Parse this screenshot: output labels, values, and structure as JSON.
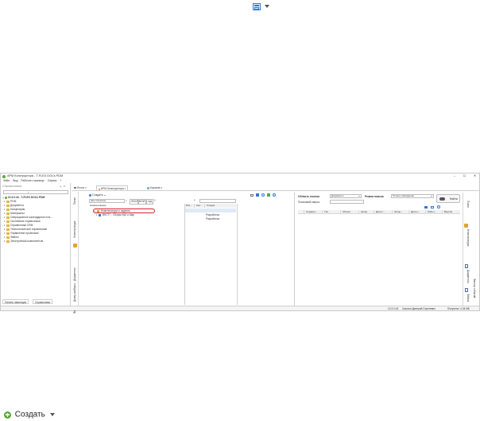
{
  "top_icon": {
    "name": "window-list-icon"
  },
  "window": {
    "title": "АРМ Конструктора - T-FLEX DOCs PDM",
    "controls": {
      "minimize": "–",
      "maximize": "☐",
      "close": "✕"
    }
  },
  "menubar": {
    "items": [
      "Файл",
      "Вид",
      "Рабочие страницы",
      "Сервис",
      "?"
    ]
  },
  "left_panel": {
    "title": "Справочники",
    "pin": "ᚁ",
    "close": "×",
    "root": "10.3.0.43 - T-FLEX DOCs PDM",
    "items": [
      "PDM",
      "Документы",
      "Канцелярия",
      "Материалы",
      "Операционное календарное пла...",
      "Системные справочники",
      "Справочники CRM",
      "Технологическое справочники",
      "Управление проектами",
      "Файлы",
      "Электронный компонентов"
    ]
  },
  "left_bottom_tabs": [
    "Панель навигации",
    "Справочники"
  ],
  "main_tabs": [
    "Почта",
    "АРМ Конструктора",
    "Корзина"
  ],
  "left_vtabs": [
    "Папки",
    "Номенклатура",
    "Документы",
    "Дочер.разборы",
    "Файлы"
  ],
  "nomenclature": {
    "create_label": "Создать",
    "filter_value": "(все объекты)",
    "filter_buttons": [
      "ФСИ",
      "КОИ",
      "ЦЦ"
    ],
    "columns": [
      "Наименование",
      "Поз...",
      "Кол...",
      "Стадия"
    ],
    "rows": [
      {
        "name": "Номенклатура и изделия",
        "stage": ""
      },
      {
        "name": "ВНСТ? - Сборка КуК и Шар",
        "stage": "Разработка"
      },
      {
        "name": "",
        "stage": "Разработка"
      }
    ]
  },
  "search": {
    "area_label": "Область поиска",
    "area_value": "Документы",
    "mode_label": "Режим поиска",
    "mode_value": "Точное совпадение",
    "query_label": "Поисковый запрос",
    "find_button": "Найти",
    "columns": [
      "Справоч...",
      "Тип",
      "Объект",
      "Автор",
      "Дата с...",
      "Автор...",
      "Дата о...",
      "Рабоч...",
      "Версия"
    ]
  },
  "right_vtabs": [
    "Поиск",
    "Номенклатура",
    "Документы",
    "Файлы",
    "Фильтр событий"
  ],
  "statusbar": {
    "server": "10.3.0.43",
    "user": "Смолин Дмитрий Сергеевич",
    "memory": "Получено: 4,34 МБ"
  },
  "bottom_toolbar": {
    "create_label": "Создать"
  },
  "colors": {
    "highlight": "#d8202a",
    "accent": "#2f7bd0",
    "folder": "#e3b64b",
    "title_icon": "#5aa83a"
  }
}
